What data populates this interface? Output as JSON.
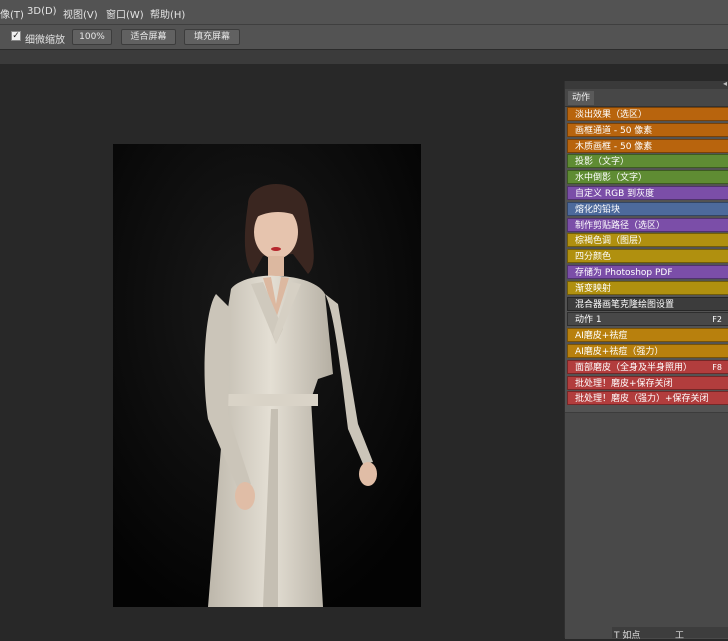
{
  "menubar": {
    "items": [
      "像(T)",
      "3D(D)",
      "视图(V)",
      "窗口(W)",
      "帮助(H)"
    ]
  },
  "options": {
    "scrubby_zoom_label": "细微缩放",
    "zoom_100": "100%",
    "fit_screen": "适合屏幕",
    "fill_screen": "填充屏幕"
  },
  "panel": {
    "tab_label": "动作",
    "actions": [
      {
        "label": "淡出效果（选区）",
        "key": "",
        "color": "#b8640d"
      },
      {
        "label": "画框通道 - 50 像素",
        "key": "",
        "color": "#b8640d"
      },
      {
        "label": "木质画框 - 50 像素",
        "key": "",
        "color": "#b8640d"
      },
      {
        "label": "投影（文字）",
        "key": "",
        "color": "#5f8c33"
      },
      {
        "label": "水中倒影（文字）",
        "key": "",
        "color": "#5f8c33"
      },
      {
        "label": "自定义 RGB 到灰度",
        "key": "",
        "color": "#7b4ea8"
      },
      {
        "label": "熔化的铅块",
        "key": "",
        "color": "#4d6a9c"
      },
      {
        "label": "制作剪贴路径（选区）",
        "key": "",
        "color": "#7b4ea8"
      },
      {
        "label": "棕褐色调（图层）",
        "key": "",
        "color": "#b0900f"
      },
      {
        "label": "四分颜色",
        "key": "",
        "color": "#b0900f"
      },
      {
        "label": "存储为 Photoshop PDF",
        "key": "",
        "color": "#7b4ea8"
      },
      {
        "label": "渐变映射",
        "key": "",
        "color": "#b0900f"
      },
      {
        "label": "混合器画笔克隆绘图设置",
        "key": "",
        "color": "#3c3c3c"
      },
      {
        "label": "动作 1",
        "key": "F2",
        "color": "#484848"
      },
      {
        "label": "AI磨皮+祛痘",
        "key": "",
        "color": "#b8800d"
      },
      {
        "label": "AI磨皮+祛痘（强力）",
        "key": "",
        "color": "#b8800d"
      },
      {
        "label": "面部磨皮（全身及半身照用）",
        "key": "F8",
        "color": "#b23d3d"
      },
      {
        "label": "批处理！磨皮+保存关闭",
        "key": "",
        "color": "#b23d3d"
      },
      {
        "label": "批处理！磨皮（强力）+保存关闭",
        "key": "",
        "color": "#b23d3d"
      }
    ]
  },
  "statusbar": {
    "left": "T 如点",
    "right": "工"
  }
}
